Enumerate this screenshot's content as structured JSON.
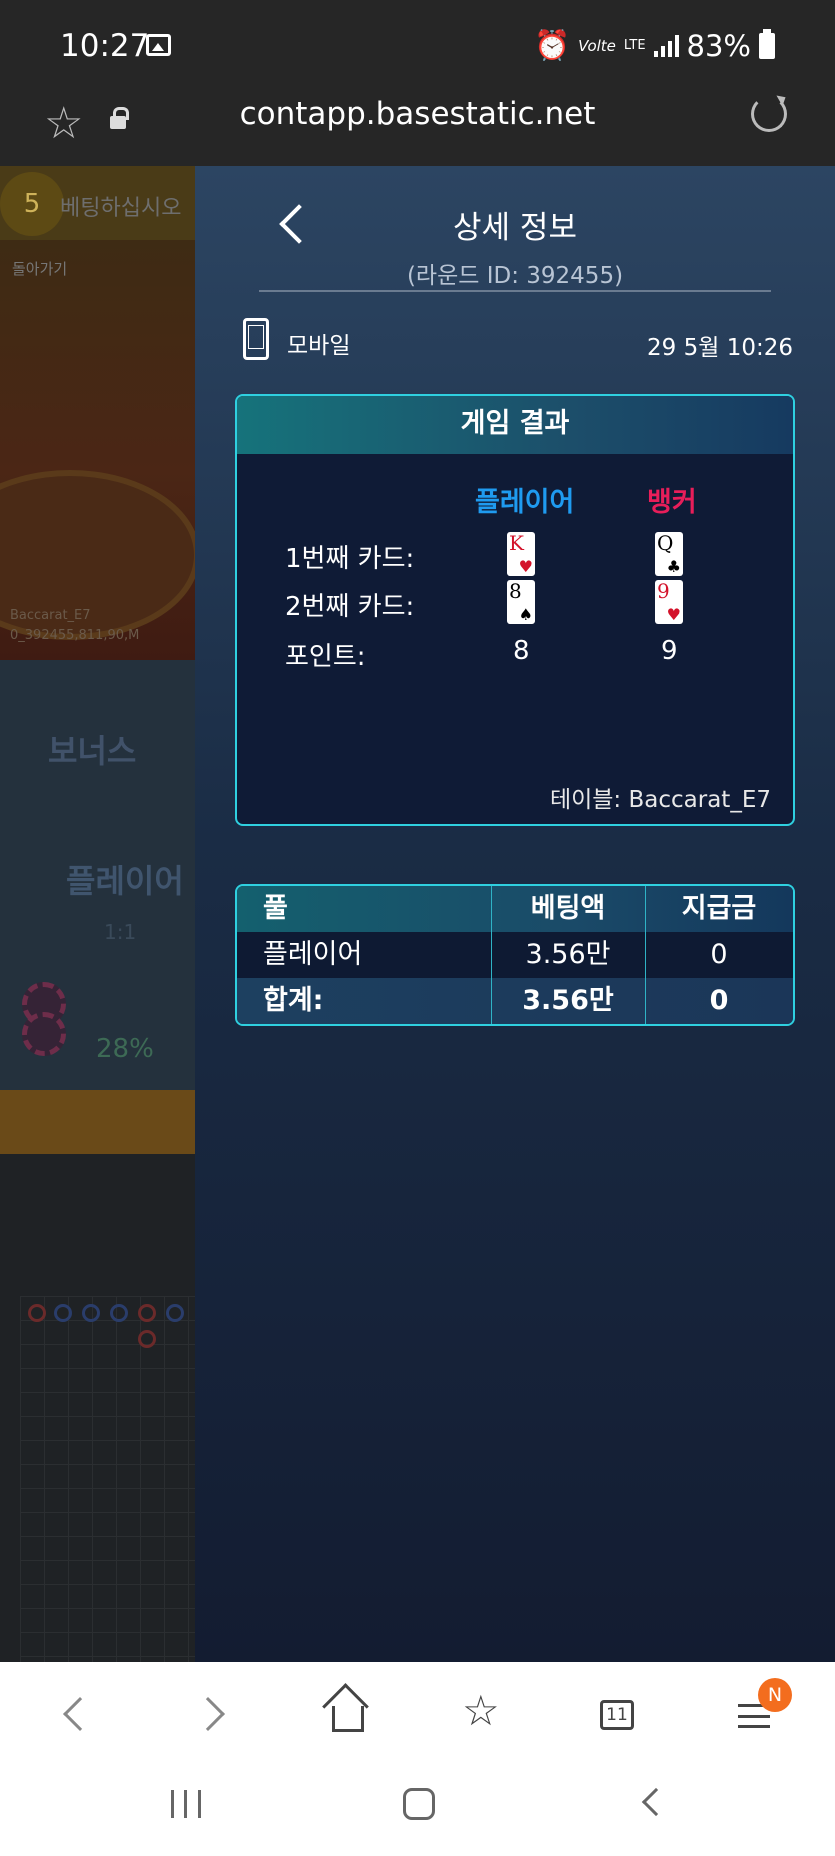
{
  "status_bar": {
    "time": "10:27",
    "network_small": "Volte",
    "network_lte": "LTE",
    "battery": "83%",
    "icons": [
      "gallery-icon",
      "alarm-icon",
      "signal-icon",
      "battery-icon"
    ]
  },
  "url_bar": {
    "url": "contapp.basestatic.net",
    "icons": [
      "bookmark-star-icon",
      "lock-icon",
      "reload-icon"
    ]
  },
  "background_game": {
    "badge": "5",
    "bet_prompt": "베팅하십시오",
    "back_label": "돌아가기",
    "table_name": "Baccarat_E7",
    "round_text": "0_392455,811,90,M",
    "bonus_label": "보너스",
    "player_label": "플레이어",
    "ratio": "1:1",
    "percent": "28%"
  },
  "detail": {
    "title": "상세 정보",
    "round_id": "(라운드 ID: 392455)",
    "device_label": "모바일",
    "date": "29  5월 10:26",
    "result": {
      "header": "게임 결과",
      "player_label": "플레이어",
      "banker_label": "뱅커",
      "card1_label": "1번째  카드:",
      "card2_label": "2번째  카드:",
      "points_label": "포인트:",
      "player_card1": {
        "rank": "K",
        "suit": "♥",
        "color": "red"
      },
      "banker_card1": {
        "rank": "Q",
        "suit": "♣",
        "color": "black"
      },
      "player_card2": {
        "rank": "8",
        "suit": "♠",
        "color": "black"
      },
      "banker_card2": {
        "rank": "9",
        "suit": "♥",
        "color": "red"
      },
      "player_points": "8",
      "banker_points": "9",
      "table_label": "테이블: Baccarat_E7"
    },
    "bet_table": {
      "headers": [
        "풀",
        "베팅액",
        "지급금"
      ],
      "rows": [
        [
          "플레이어",
          "3.56만",
          "0"
        ]
      ],
      "total": [
        "합계:",
        "3.56만",
        "0"
      ]
    }
  },
  "browser_nav": {
    "tab_count": "11",
    "notification": "N",
    "icons": [
      "back-icon",
      "forward-icon",
      "home-icon",
      "bookmarks-icon",
      "tabs-icon",
      "menu-icon"
    ]
  },
  "system_nav": {
    "icons": [
      "recents-icon",
      "home-icon",
      "back-icon"
    ]
  },
  "colors": {
    "player": "#1f9bf0",
    "banker": "#e81e5a",
    "accent_border": "#2fd0e0",
    "notification": "#f36d1e"
  }
}
